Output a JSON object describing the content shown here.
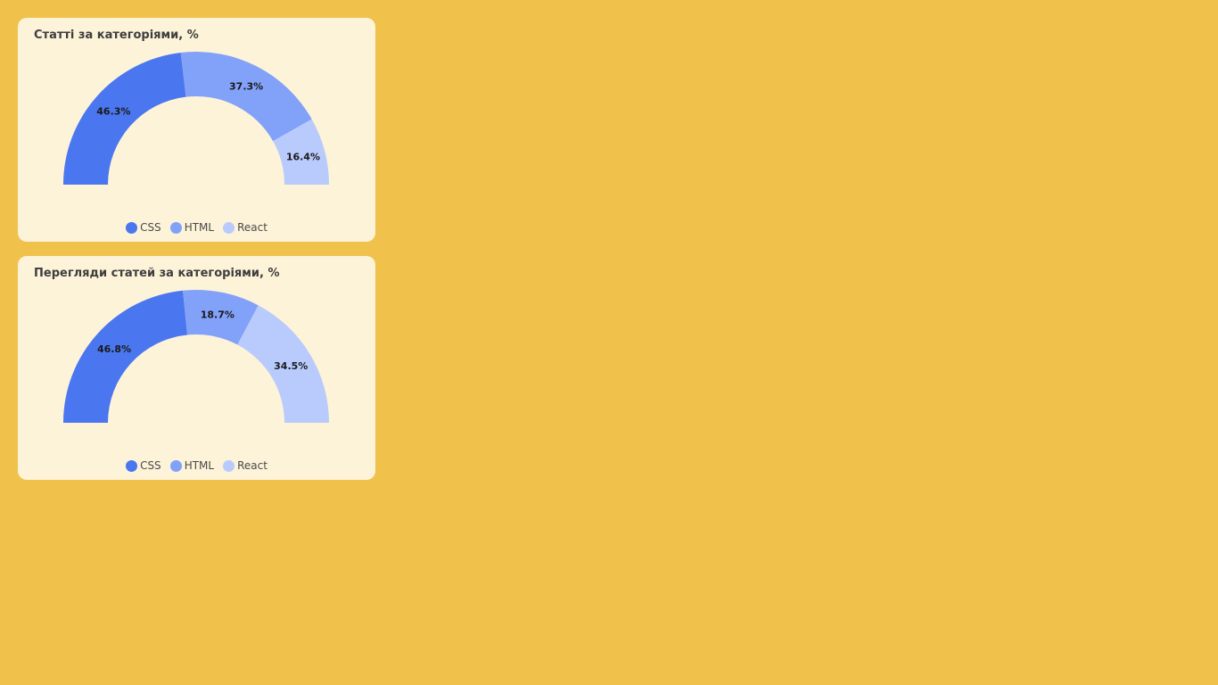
{
  "chart_data": [
    {
      "type": "pie",
      "title": "Статті за категоріями, %",
      "categories": [
        "CSS",
        "HTML",
        "React"
      ],
      "values": [
        46.3,
        37.3,
        16.4
      ],
      "data_labels": [
        "46.3%",
        "37.3%",
        "16.4%"
      ],
      "colors": [
        "#4a77ef",
        "#82a1f9",
        "#b9cbfd"
      ],
      "legend": "bottom-center"
    },
    {
      "type": "pie",
      "title": "Перегляди статей за категоріями, %",
      "categories": [
        "CSS",
        "HTML",
        "React"
      ],
      "values": [
        46.8,
        18.7,
        34.5
      ],
      "data_labels": [
        "46.8%",
        "18.7%",
        "34.5%"
      ],
      "colors": [
        "#4a77ef",
        "#82a1f9",
        "#b9cbfd"
      ],
      "legend": "bottom-center"
    }
  ]
}
